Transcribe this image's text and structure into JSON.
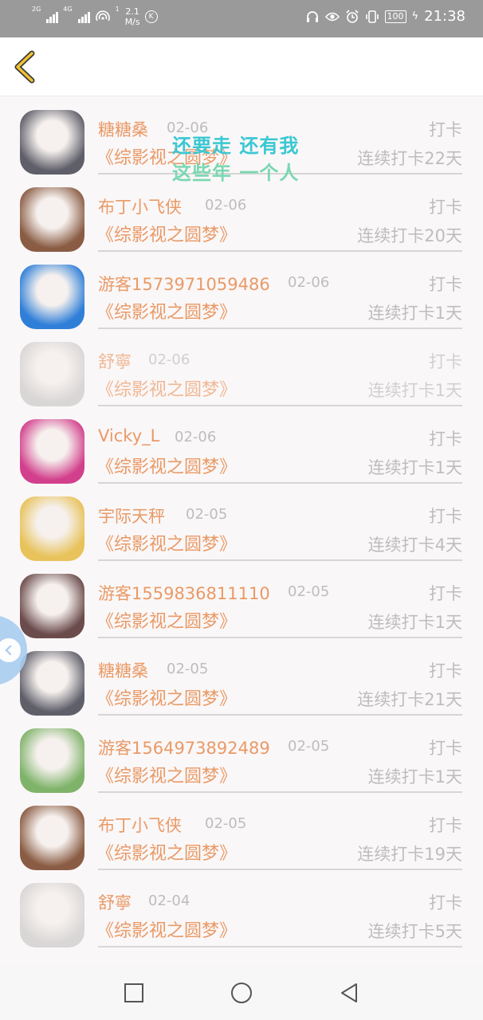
{
  "status_bar": {
    "net1": "2G",
    "net2": "4G",
    "hotspot_count": "1",
    "speed_value": "2.1",
    "speed_unit": "M/s",
    "k_badge": "K",
    "battery": "100",
    "time": "21:38"
  },
  "header": {
    "back_icon": "chevron-left-icon"
  },
  "overlay": {
    "lyric_line1": "还要走 还有我",
    "lyric_line2": "这些年 一个人",
    "float_icon": "chevron-left-icon"
  },
  "rows": [
    {
      "name": "糖糖桑",
      "date": "02-06",
      "action": "打卡",
      "book": "《综影视之圆梦》",
      "streak": "连续打卡22天",
      "faded": false,
      "avatar_color": "#5f5f6a"
    },
    {
      "name": "布丁小飞侠",
      "date": "02-06",
      "action": "打卡",
      "book": "《综影视之圆梦》",
      "streak": "连续打卡20天",
      "faded": false,
      "avatar_color": "#8a5c44"
    },
    {
      "name": "游客1573971059486",
      "date": "02-06",
      "action": "打卡",
      "book": "《综影视之圆梦》",
      "streak": "连续打卡1天",
      "faded": false,
      "avatar_color": "#2f7fd8"
    },
    {
      "name": "舒寧",
      "date": "02-06",
      "action": "打卡",
      "book": "《综影视之圆梦》",
      "streak": "连续打卡1天",
      "faded": true,
      "avatar_color": "#d9d6d6"
    },
    {
      "name": "Vicky_L",
      "date": "02-06",
      "action": "打卡",
      "book": "《综影视之圆梦》",
      "streak": "连续打卡1天",
      "faded": false,
      "avatar_color": "#d23f8c"
    },
    {
      "name": "宇际天秤",
      "date": "02-05",
      "action": "打卡",
      "book": "《综影视之圆梦》",
      "streak": "连续打卡4天",
      "faded": false,
      "avatar_color": "#e8c25a"
    },
    {
      "name": "游客1559836811110",
      "date": "02-05",
      "action": "打卡",
      "book": "《综影视之圆梦》",
      "streak": "连续打卡1天",
      "faded": false,
      "avatar_color": "#6b4b4b"
    },
    {
      "name": "糖糖桑",
      "date": "02-05",
      "action": "打卡",
      "book": "《综影视之圆梦》",
      "streak": "连续打卡21天",
      "faded": false,
      "avatar_color": "#5f5f6a"
    },
    {
      "name": "游客1564973892489",
      "date": "02-05",
      "action": "打卡",
      "book": "《综影视之圆梦》",
      "streak": "连续打卡1天",
      "faded": false,
      "avatar_color": "#7fb36a"
    },
    {
      "name": "布丁小飞侠",
      "date": "02-05",
      "action": "打卡",
      "book": "《综影视之圆梦》",
      "streak": "连续打卡19天",
      "faded": false,
      "avatar_color": "#8a5c44"
    },
    {
      "name": "舒寧",
      "date": "02-04",
      "action": "打卡",
      "book": "《综影视之圆梦》",
      "streak": "连续打卡5天",
      "faded": false,
      "avatar_color": "#d9d6d6"
    }
  ],
  "nav": {
    "recent_icon": "square-icon",
    "home_icon": "circle-icon",
    "back_icon": "triangle-back-icon"
  }
}
